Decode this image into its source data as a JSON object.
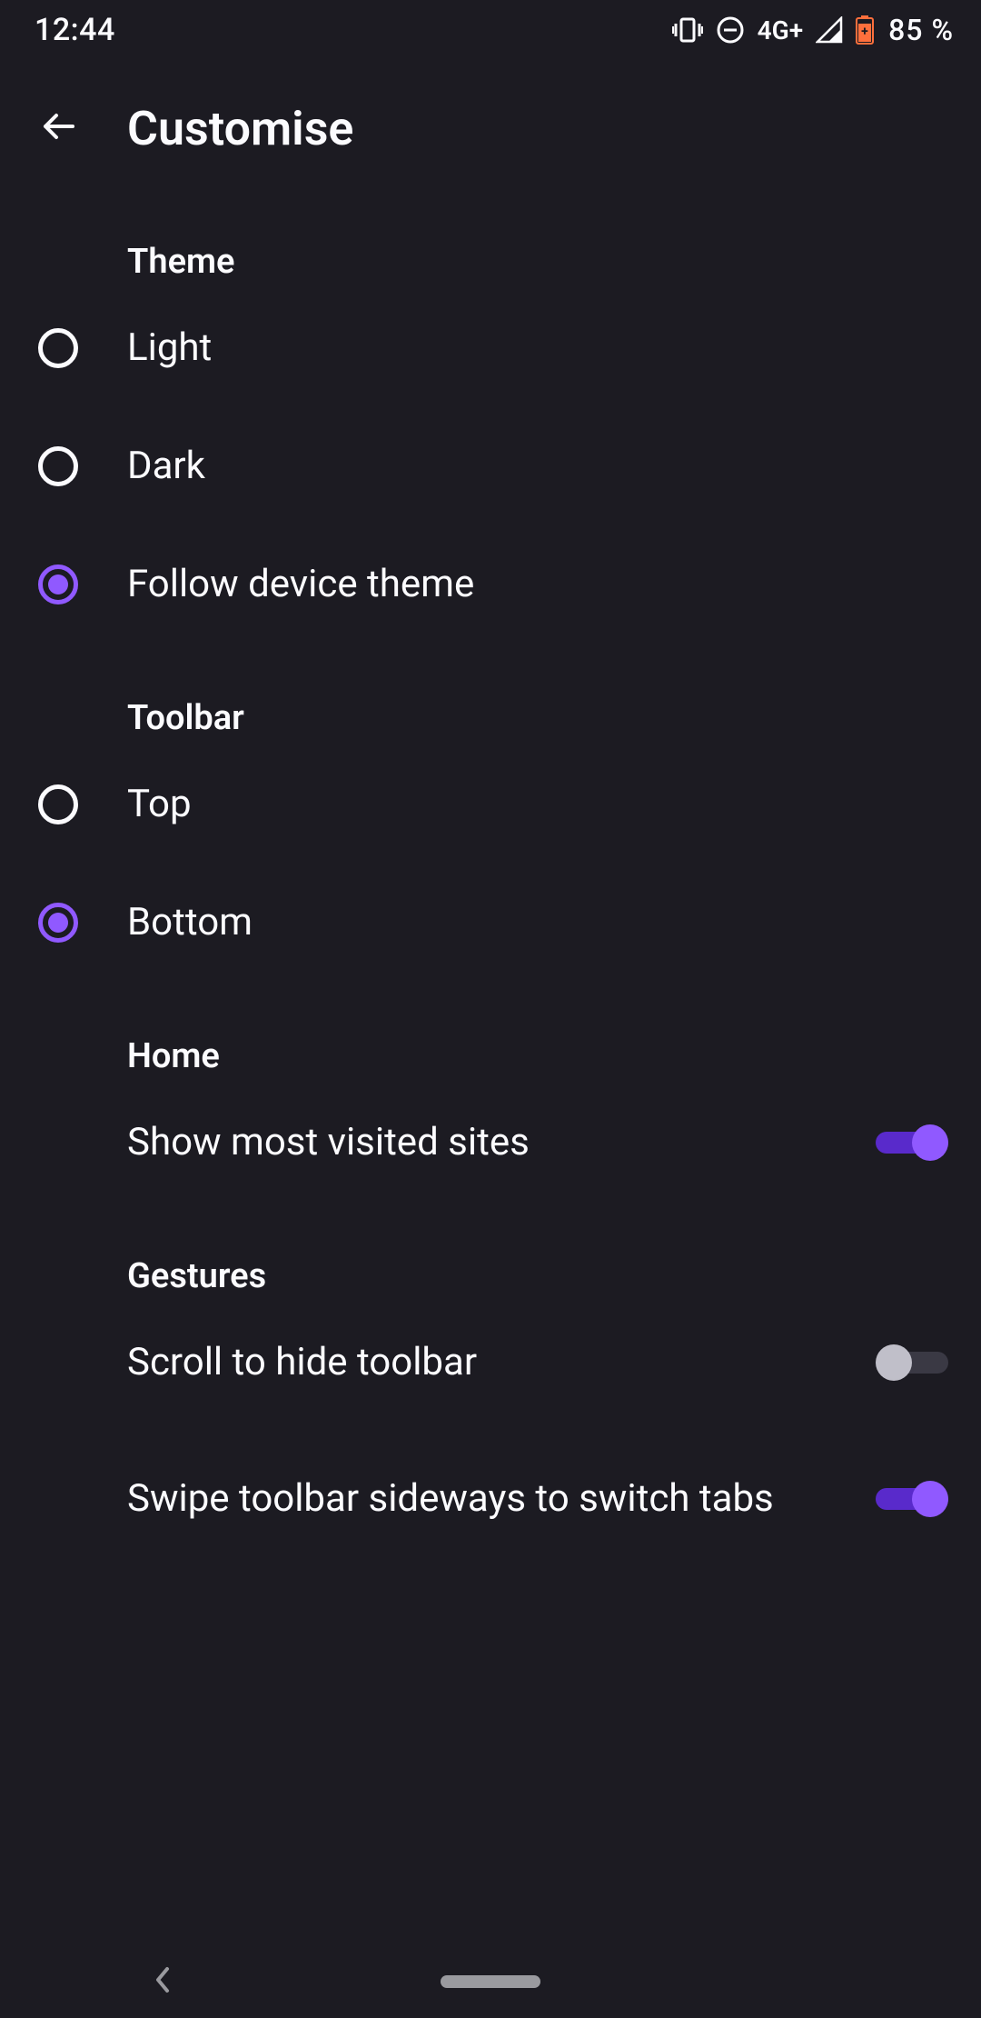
{
  "status": {
    "time": "12:44",
    "network": "4G+",
    "battery": "85 %"
  },
  "header": {
    "title": "Customise"
  },
  "sections": {
    "theme": {
      "heading": "Theme",
      "options": {
        "light": {
          "label": "Light",
          "selected": false
        },
        "dark": {
          "label": "Dark",
          "selected": false
        },
        "follow_device": {
          "label": "Follow device theme",
          "selected": true
        }
      }
    },
    "toolbar": {
      "heading": "Toolbar",
      "options": {
        "top": {
          "label": "Top",
          "selected": false
        },
        "bottom": {
          "label": "Bottom",
          "selected": true
        }
      }
    },
    "home": {
      "heading": "Home",
      "show_most_visited": {
        "label": "Show most visited sites",
        "value": true
      }
    },
    "gestures": {
      "heading": "Gestures",
      "scroll_hide": {
        "label": "Scroll to hide toolbar",
        "value": false
      },
      "swipe_tabs": {
        "label": "Swipe toolbar sideways to switch tabs",
        "value": true
      }
    }
  },
  "colors": {
    "accent": "#9059ff",
    "background": "#1c1b22",
    "text": "#fbfbfe"
  }
}
